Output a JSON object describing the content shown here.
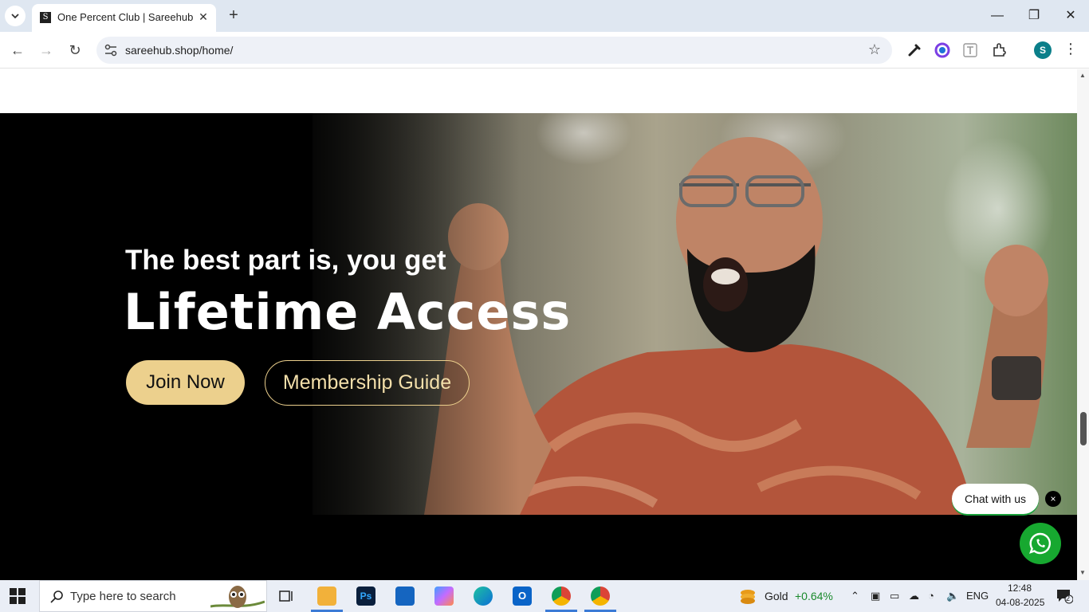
{
  "browser": {
    "tab_title": "One Percent Club | Sareehub",
    "favicon_letter": "S",
    "url": "sareehub.shop/home/",
    "profile_initial": "S"
  },
  "hero": {
    "subtitle": "The best part is, you get",
    "title": "Lifetime Access",
    "join_label": "Join Now",
    "guide_label": "Membership Guide"
  },
  "chat": {
    "label": "Chat with us",
    "close_label": "×"
  },
  "taskbar": {
    "search_placeholder": "Type here to search",
    "widget_label": "Gold",
    "widget_value": "+0.64%",
    "language": "ENG",
    "time": "12:48",
    "date": "04-08-2025",
    "notification_count": "2"
  },
  "colors": {
    "accent_gold": "#ecd08d",
    "whatsapp_green": "#17a830"
  }
}
